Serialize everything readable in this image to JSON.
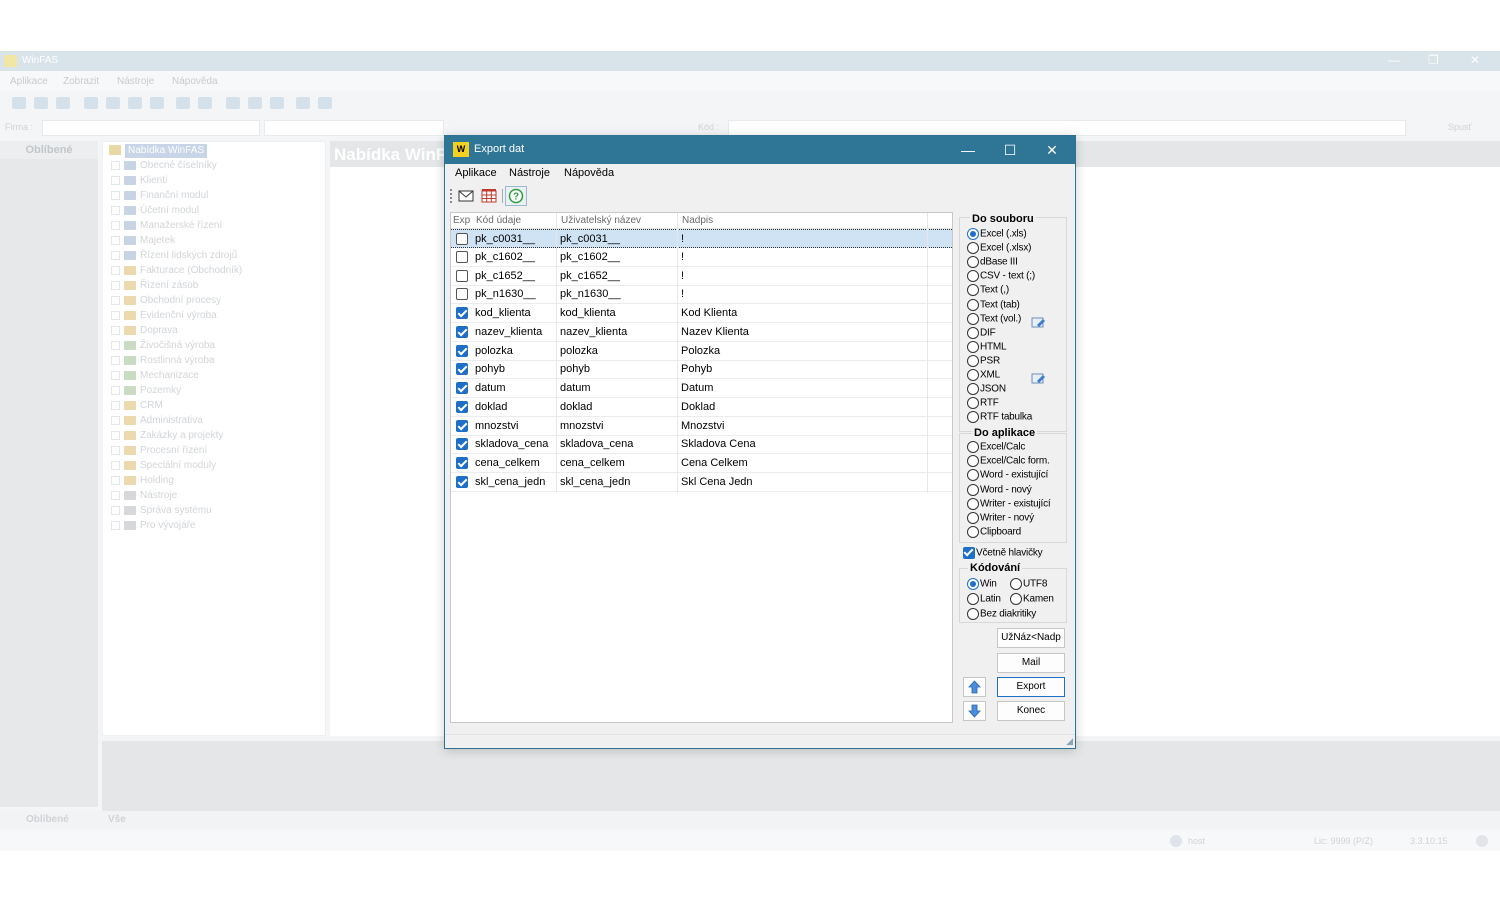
{
  "background_app": {
    "title": "WinFAS",
    "menu": [
      "Aplikace",
      "Zobrazit",
      "Nástroje",
      "Nápověda"
    ],
    "firma_label": "Firma :",
    "kod_label": "Kód :",
    "spust_label": "Spusť",
    "favorites_header": "Oblíbené",
    "tree_root": "Nabídka WinFAS",
    "tree_items": [
      "Obecné číselníky",
      "Klienti",
      "Finanční modul",
      "Účetní modul",
      "Manažerské řízení",
      "Majetek",
      "Řízení lidských zdrojů",
      "Fakturace (Obchodník)",
      "Řízení zásob",
      "Obchodní procesy",
      "Evidenční výroba",
      "Doprava",
      "Živočišná výroba",
      "Rostlinná výroba",
      "Mechanizace",
      "Pozemky",
      "CRM",
      "Administrativa",
      "Zakázky a projekty",
      "Procesní řízení",
      "Speciální moduly",
      "Holding",
      "Nástroje",
      "Správa systému",
      "Pro vývojáře"
    ],
    "main_band_title": "Nabídka WinFAS",
    "bottom_tabs": [
      "Oblíbené",
      "Vše"
    ],
    "status": {
      "user": "host",
      "license": "Lic: 9999 (P/Z)",
      "version": "3.3.10.15"
    }
  },
  "dialog": {
    "title": "Export dat",
    "logo_text": "W",
    "window_controls": {
      "minimize": "—",
      "maximize": "☐",
      "close": "✕"
    },
    "menu": [
      "Aplikace",
      "Nástroje",
      "Nápověda"
    ],
    "toolbar": {
      "icons": [
        "mail-icon",
        "grid-icon",
        "help-icon"
      ],
      "help_glyph": "?"
    },
    "grid": {
      "headers": [
        "Exp",
        "Kód údaje",
        "Uživatelský název",
        "Nadpis"
      ],
      "rows": [
        {
          "checked": false,
          "kod": "pk_c0031__",
          "nazev": "pk_c0031__",
          "nadpis": "!",
          "selected": true
        },
        {
          "checked": false,
          "kod": "pk_c1602__",
          "nazev": "pk_c1602__",
          "nadpis": "!"
        },
        {
          "checked": false,
          "kod": "pk_c1652__",
          "nazev": "pk_c1652__",
          "nadpis": "!"
        },
        {
          "checked": false,
          "kod": "pk_n1630__",
          "nazev": "pk_n1630__",
          "nadpis": "!"
        },
        {
          "checked": true,
          "kod": "kod_klienta",
          "nazev": "kod_klienta",
          "nadpis": "Kod Klienta"
        },
        {
          "checked": true,
          "kod": "nazev_klienta",
          "nazev": "nazev_klienta",
          "nadpis": "Nazev Klienta"
        },
        {
          "checked": true,
          "kod": "polozka",
          "nazev": "polozka",
          "nadpis": "Polozka"
        },
        {
          "checked": true,
          "kod": "pohyb",
          "nazev": "pohyb",
          "nadpis": "Pohyb"
        },
        {
          "checked": true,
          "kod": "datum",
          "nazev": "datum",
          "nadpis": "Datum"
        },
        {
          "checked": true,
          "kod": "doklad",
          "nazev": "doklad",
          "nadpis": "Doklad"
        },
        {
          "checked": true,
          "kod": "mnozstvi",
          "nazev": "mnozstvi",
          "nadpis": "Mnozstvi"
        },
        {
          "checked": true,
          "kod": "skladova_cena",
          "nazev": "skladova_cena",
          "nadpis": "Skladova Cena"
        },
        {
          "checked": true,
          "kod": "cena_celkem",
          "nazev": "cena_celkem",
          "nadpis": "Cena Celkem"
        },
        {
          "checked": true,
          "kod": "skl_cena_jedn",
          "nazev": "skl_cena_jedn",
          "nadpis": "Skl Cena Jedn"
        }
      ]
    },
    "do_souboru": {
      "title": "Do souboru",
      "selected": "Excel (.xls)",
      "options": [
        "Excel (.xls)",
        "Excel (.xlsx)",
        "dBase III",
        "CSV - text (;)",
        "Text (,)",
        "Text (tab)",
        "Text (vol.)",
        "DIF",
        "HTML",
        "PSR",
        "XML",
        "JSON",
        "RTF",
        "RTF tabulka"
      ]
    },
    "do_aplikace": {
      "title": "Do aplikace",
      "options": [
        "Excel/Calc",
        "Excel/Calc form.",
        "Word - existující",
        "Word - nový",
        "Writer - existující",
        "Writer - nový",
        "Clipboard"
      ]
    },
    "vcetne_hlavicky": {
      "label": "Včetně hlavičky",
      "checked": true
    },
    "kodovani": {
      "title": "Kódování",
      "selected": "Win",
      "options": [
        "Win",
        "UTF8",
        "Latin",
        "Kamen",
        "Bez diakritiky"
      ]
    },
    "buttons": {
      "uzn": "UžNáz<Nadp",
      "mail": "Mail",
      "export": "Export",
      "konec": "Konec"
    },
    "colors": {
      "titlebar": "#2e7596",
      "accent": "#1e6fc7",
      "selected_row": "#cfe3f5"
    }
  }
}
